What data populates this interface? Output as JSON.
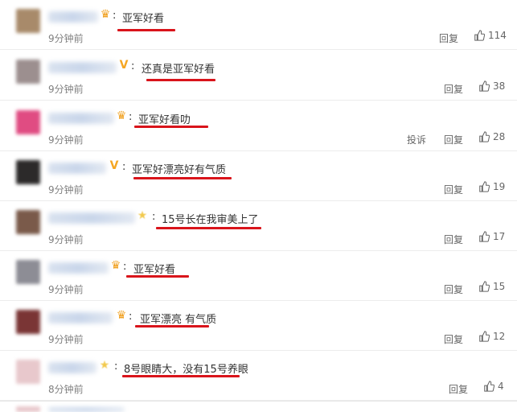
{
  "comments": [
    {
      "text": "亚军好看",
      "time": "9分钟前",
      "reply": "回复",
      "likes": "114",
      "badge": "crown",
      "avatar_color": "#a88a6a"
    },
    {
      "text": "还真是亚军好看",
      "time": "9分钟前",
      "reply": "回复",
      "likes": "38",
      "badge": "v",
      "avatar_color": "#9c8f8f"
    },
    {
      "text": "亚军好看叻",
      "time": "9分钟前",
      "reply": "回复",
      "report": "投诉",
      "likes": "28",
      "badge": "crown",
      "avatar_color": "#e04c82"
    },
    {
      "text": "亚军好漂亮好有气质",
      "time": "9分钟前",
      "reply": "回复",
      "likes": "19",
      "badge": "v",
      "avatar_color": "#2c2a2a"
    },
    {
      "text": "15号长在我审美上了",
      "time": "9分钟前",
      "reply": "回复",
      "likes": "17",
      "badge": "star",
      "avatar_color": "#7a5a4a"
    },
    {
      "text": "亚军好看",
      "time": "9分钟前",
      "reply": "回复",
      "likes": "15",
      "badge": "crown",
      "avatar_color": "#8d8d95"
    },
    {
      "text": "亚军漂亮 有气质",
      "time": "9分钟前",
      "reply": "回复",
      "likes": "12",
      "badge": "crown",
      "avatar_color": "#7a3535"
    },
    {
      "text": "8号眼睛大，没有15号养眼",
      "time": "8分钟前",
      "reply": "回复",
      "likes": "4",
      "badge": "star",
      "avatar_color": "#e8c8cc"
    }
  ],
  "colors": {
    "underline": "#d9141b",
    "time": "#808080",
    "action": "#666666"
  },
  "icons": {
    "like": "thumbs-up-icon"
  }
}
